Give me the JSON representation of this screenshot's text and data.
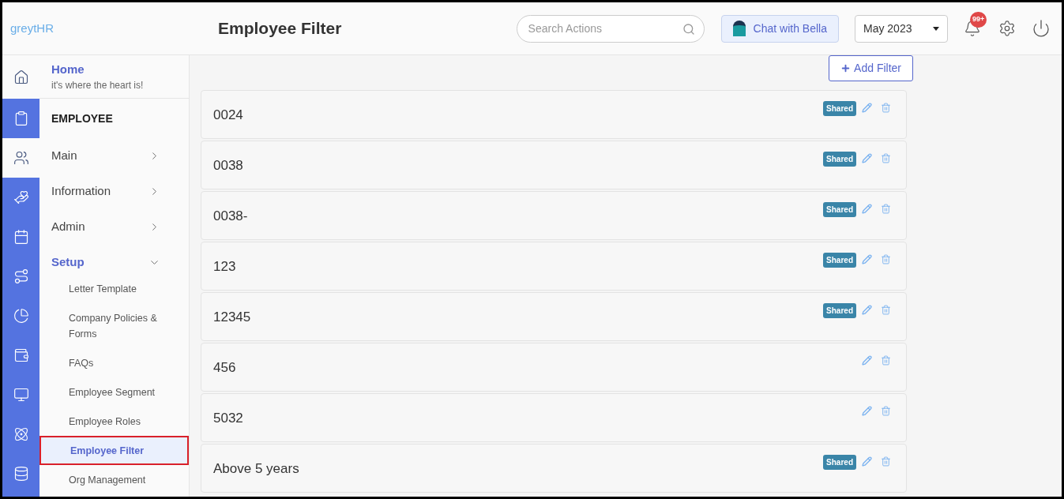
{
  "header": {
    "logo": "greytHR",
    "title": "Employee Filter",
    "search": {
      "placeholder": "Search Actions"
    },
    "chat_button": "Chat with Bella",
    "month_select": "May 2023",
    "notification_badge": "99+"
  },
  "rail": [
    {
      "selected": true
    },
    {
      "selected": false
    },
    {
      "selected": true
    },
    {
      "selected": false
    },
    {
      "selected": false
    },
    {
      "selected": false
    },
    {
      "selected": false
    },
    {
      "selected": false
    },
    {
      "selected": false
    },
    {
      "selected": false
    },
    {
      "selected": false
    }
  ],
  "sidebar": {
    "home": {
      "title": "Home",
      "subtitle": "it's where the heart is!"
    },
    "section": "EMPLOYEE",
    "items": [
      {
        "label": "Main",
        "expanded": false
      },
      {
        "label": "Information",
        "expanded": false
      },
      {
        "label": "Admin",
        "expanded": false
      },
      {
        "label": "Setup",
        "expanded": true,
        "children": [
          {
            "label": "Letter Template",
            "selected": false
          },
          {
            "label": "Company Policies & Forms",
            "selected": false
          },
          {
            "label": "FAQs",
            "selected": false
          },
          {
            "label": "Employee Segment",
            "selected": false
          },
          {
            "label": "Employee Roles",
            "selected": false
          },
          {
            "label": "Employee Filter",
            "selected": true
          },
          {
            "label": "Org Management",
            "selected": false
          }
        ]
      }
    ]
  },
  "add_filter_button": "Add Filter",
  "filters": [
    {
      "name": "0024",
      "badge": "Shared"
    },
    {
      "name": "0038",
      "badge": "Shared"
    },
    {
      "name": "0038-",
      "badge": "Shared"
    },
    {
      "name": "123",
      "badge": "Shared"
    },
    {
      "name": "12345",
      "badge": "Shared"
    },
    {
      "name": "456"
    },
    {
      "name": "5032"
    },
    {
      "name": "Above 5 years",
      "badge": "Shared"
    }
  ]
}
